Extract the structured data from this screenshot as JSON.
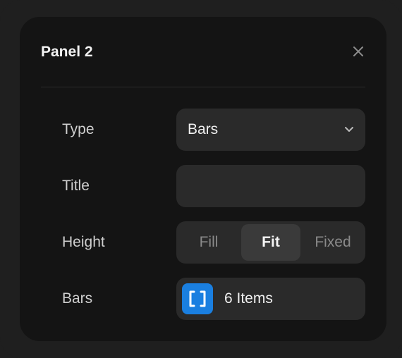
{
  "panel": {
    "title": "Panel 2",
    "close_icon": "close-icon"
  },
  "fields": {
    "type": {
      "label": "Type",
      "value": "Bars",
      "icon": "chevron-down-icon"
    },
    "title": {
      "label": "Title",
      "value": ""
    },
    "height": {
      "label": "Height",
      "options": [
        "Fill",
        "Fit",
        "Fixed"
      ],
      "selected": "Fit"
    },
    "bars": {
      "label": "Bars",
      "icon": "array-brackets-icon",
      "value": "6 Items"
    }
  },
  "colors": {
    "accent": "#1a7fe0",
    "panel_bg": "#141414",
    "control_bg": "#2a2a2a",
    "segment_active_bg": "#3a3a3a"
  }
}
